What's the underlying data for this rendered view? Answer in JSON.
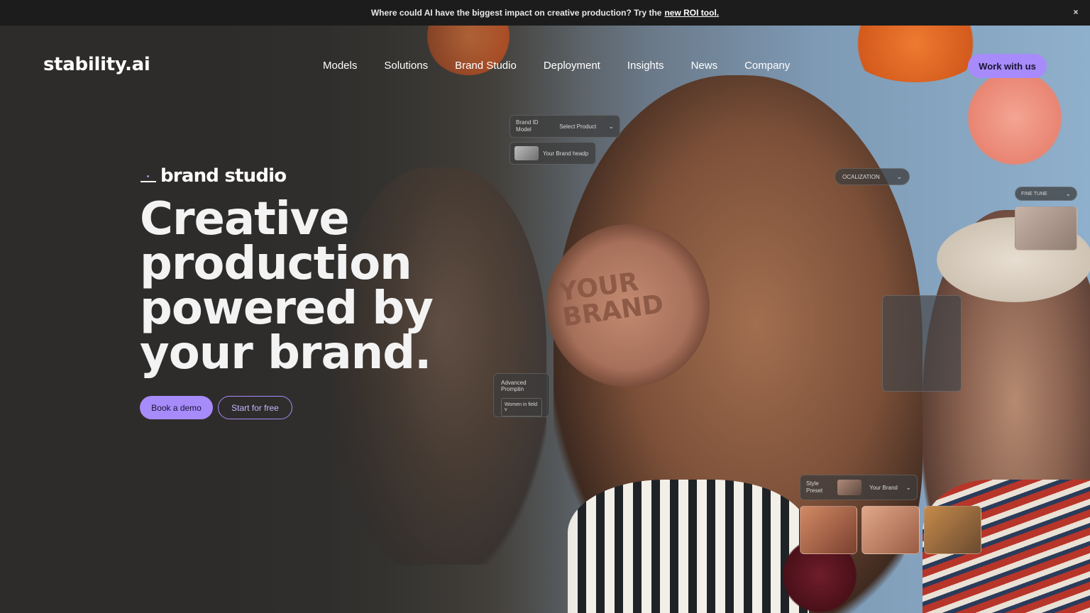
{
  "announcement": {
    "text": "Where could AI have the biggest impact on creative production? Try the",
    "link": "new ROI tool.",
    "close": "×"
  },
  "header": {
    "logo": "stability.ai",
    "nav": [
      "Models",
      "Solutions",
      "Brand Studio",
      "Deployment",
      "Insights",
      "News",
      "Company"
    ],
    "cta": "Work with us"
  },
  "hero": {
    "eyebrow": "brand studio",
    "headline": [
      "Creative",
      "production",
      "powered by",
      "your brand."
    ],
    "primary_button": "Book a demo",
    "secondary_button": "Start for free"
  },
  "overlay_ui": {
    "brand_model_label": "Brand ID Model",
    "select_product": "Select Product",
    "brand_item": "Your Brand headp",
    "localization": "OCALIZATION",
    "fine_tune": "FINE TUNE",
    "advanced_prompting": "Advanced Promptin",
    "prompt_value": "Women in field v",
    "style_preset_label": "Style Preset",
    "style_preset_value": "Your Brand",
    "headphone_text": "YOUR BRAND"
  },
  "colors": {
    "accent": "#a78bfa",
    "announcement_bg": "#1c1c1c",
    "hero_dark": "#2d2c2a"
  }
}
